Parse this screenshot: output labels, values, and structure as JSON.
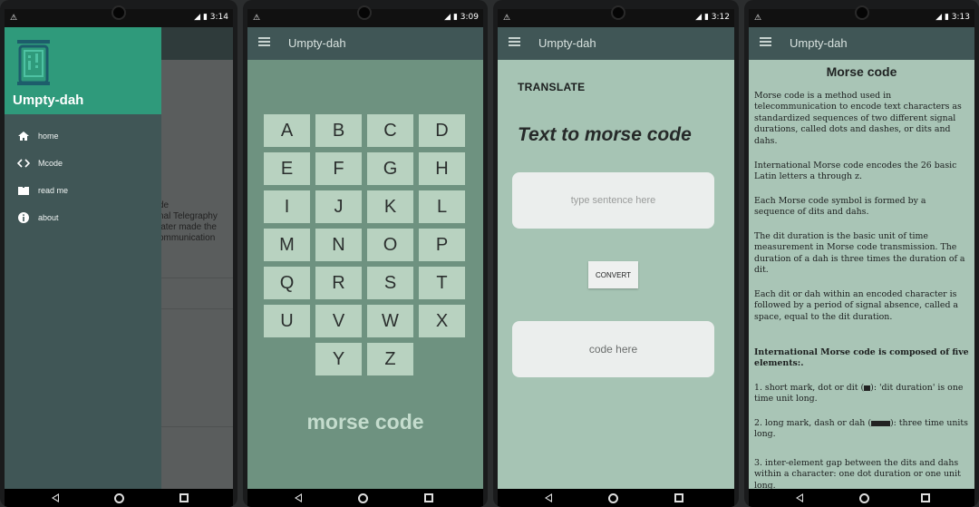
{
  "status": {
    "phone1_time": "3:14",
    "phone2_time": "3:09",
    "phone3_time": "3:12",
    "phone4_time": "3:13",
    "alert_icon": "⚠"
  },
  "app": {
    "title": "Umpty-dah"
  },
  "drawer": {
    "title": "Umpty-dah",
    "items": [
      {
        "label": "home",
        "icon": "home-icon"
      },
      {
        "label": "Mcode",
        "icon": "code-icon"
      },
      {
        "label": "read me",
        "icon": "book-icon"
      },
      {
        "label": "about",
        "icon": "info-icon"
      }
    ],
    "background_text": [
      "t",
      "de",
      "nal Telegraphy",
      "later made the",
      "ommunication"
    ]
  },
  "keyboard": {
    "rows": [
      [
        "A",
        "B",
        "C",
        "D"
      ],
      [
        "E",
        "F",
        "G",
        "H"
      ],
      [
        "I",
        "J",
        "K",
        "L"
      ],
      [
        "M",
        "N",
        "O",
        "P"
      ],
      [
        "Q",
        "R",
        "S",
        "T"
      ],
      [
        "U",
        "V",
        "W",
        "X"
      ],
      [
        "Y",
        "Z"
      ]
    ],
    "footer": "morse code"
  },
  "translate": {
    "section_label": "TRANSLATE",
    "heading": "Text to morse code",
    "input_placeholder": "type sentence here",
    "convert_label": "CONVERT",
    "output_text": "code here"
  },
  "info": {
    "title": "Morse code",
    "paragraphs": [
      "Morse code is a method used in telecommunication to encode text characters as standardized sequences of two different signal durations, called dots and dashes, or dits and dahs.",
      "International Morse code encodes the 26 basic Latin letters a through z.",
      "Each Morse code symbol is formed by a sequence of dits and dahs.",
      "The dit duration is the basic unit of time measurement in Morse code transmission. The duration of a dah is three times the duration of a dit.",
      "Each dit or dah within an encoded character is followed by a period of signal absence, called a space, equal to the dit duration.",
      "International Morse code is composed of five elements:.",
      "1. short mark, dot or dit (",
      "): 'dit duration' is one time unit long.",
      "2. long mark, dash or dah (",
      "): three time units long.",
      "3. inter-element gap between the dits and dahs within a character: one dot duration or one unit long."
    ]
  },
  "colors": {
    "drawer_header": "#2f9a7b",
    "drawer_bg": "#405656",
    "keyboard_bg": "#6e9280",
    "key_bg": "#b8d2c0",
    "translate_bg": "#a6c4b4"
  }
}
